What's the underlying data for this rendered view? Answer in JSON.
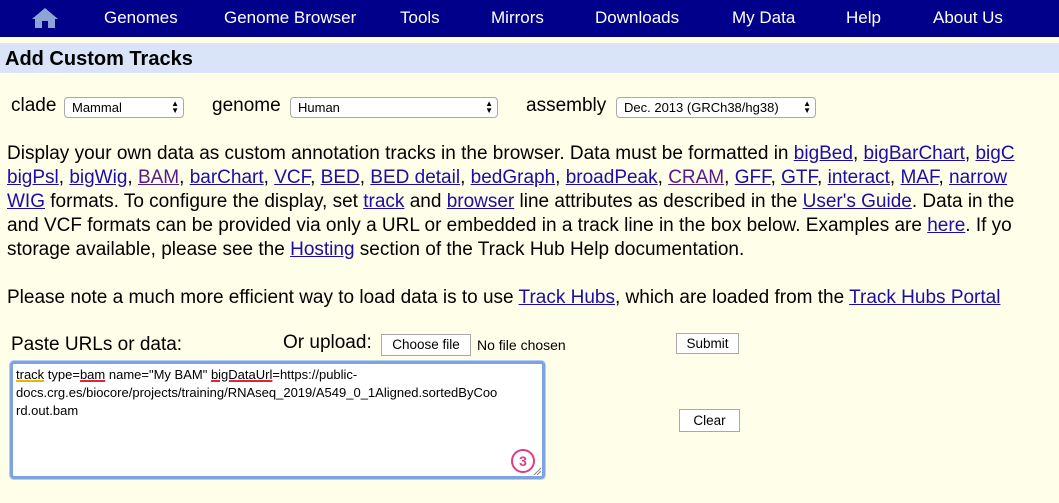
{
  "nav": {
    "home_icon": "home-icon",
    "items": [
      "Genomes",
      "Genome Browser",
      "Tools",
      "Mirrors",
      "Downloads",
      "My Data",
      "Help",
      "About Us"
    ]
  },
  "title": "Add Custom Tracks",
  "selectors": {
    "clade": {
      "label": "clade",
      "value": "Mammal"
    },
    "genome": {
      "label": "genome",
      "value": "Human"
    },
    "assembly": {
      "label": "assembly",
      "value": "Dec. 2013 (GRCh38/hg38)"
    }
  },
  "intro": {
    "l1_text": "Display your own data as custom annotation tracks in the browser. Data must be formatted in ",
    "l1_links": [
      "bigBed",
      "bigBarChart",
      "bigC"
    ],
    "l2_links": [
      "bigPsl",
      "bigWig",
      "BAM",
      "barChart",
      "VCF",
      "BED",
      "BED detail",
      "bedGraph",
      "broadPeak",
      "CRAM",
      "GFF",
      "GTF",
      "interact",
      "MAF",
      "narrow"
    ],
    "l3_link1": "WIG",
    "l3_t1": " formats. To configure the display, set ",
    "l3_link2": "track",
    "l3_t2": " and ",
    "l3_link3": "browser",
    "l3_t3": " line attributes as described in the ",
    "l3_link4": "User's Guide",
    "l3_t4": ". Data in the",
    "l4_t1": "and VCF formats can be provided via only a URL or embedded in a track line in the box below. Examples are ",
    "l4_link": "here",
    "l4_t2": ". If yo",
    "l5_t1": "storage available, please see the ",
    "l5_link": "Hosting",
    "l5_t2": " section of the Track Hub Help documentation."
  },
  "hubs_note": {
    "t1": "Please note a much more efficient way to load data is to use ",
    "link1": "Track Hubs",
    "t2": ", which are loaded from the ",
    "link2": "Track Hubs Portal"
  },
  "form": {
    "paste_label": "Paste URLs or data:",
    "upload_label": "Or upload:",
    "choose_file": "Choose file",
    "file_status": "No file chosen",
    "submit": "Submit",
    "clear": "Clear",
    "textarea": {
      "w_track": "track",
      "t1": " type=",
      "w_bam": "bam",
      "t2": " name=\"My BAM\" ",
      "w_bigDataUrl": "bigDataUrl",
      "t3": "=https://public-",
      "line2": "docs.crg.es/biocore/projects/training/RNAseq_2019/A549_0_1Aligned.sortedByCoo",
      "line3": "rd.out.bam"
    },
    "step_badge": "3"
  },
  "colors": {
    "nav_bg": "#00008B",
    "page_bg": "#FFFEE8",
    "title_bg": "#D9E4F8",
    "link": "#1A0DAB",
    "visited_link": "#551A8B",
    "badge": "#E23B84"
  }
}
